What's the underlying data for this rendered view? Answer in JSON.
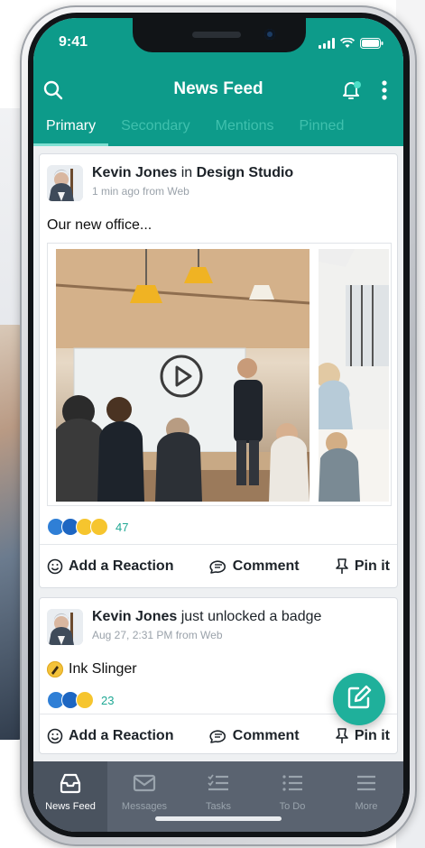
{
  "status_bar": {
    "time": "9:41"
  },
  "header": {
    "title": "News Feed",
    "icons": [
      "search-icon",
      "bell-icon",
      "more-vertical-icon"
    ]
  },
  "tabs": [
    {
      "label": "Primary",
      "active": true
    },
    {
      "label": "Secondary",
      "active": false
    },
    {
      "label": "Mentions",
      "active": false
    },
    {
      "label": "Pinned",
      "active": false
    }
  ],
  "posts": [
    {
      "author": "Kevin Jones",
      "connector": "in",
      "target": "Design Studio",
      "meta": "1 min ago from Web",
      "text": "Our new office...",
      "reaction_count": "47",
      "actions": {
        "react": "Add a Reaction",
        "comment": "Comment",
        "pin": "Pin it"
      }
    },
    {
      "author": "Kevin Jones",
      "activity": "just unlocked a badge",
      "meta": "Aug 27, 2:31 PM from Web",
      "badge_name": "Ink Slinger",
      "reaction_count": "23",
      "actions": {
        "react": "Add a Reaction",
        "comment": "Comment",
        "pin": "Pin it"
      }
    }
  ],
  "bottom_nav": [
    {
      "label": "News Feed",
      "icon": "inbox-icon",
      "active": true
    },
    {
      "label": "Messages",
      "icon": "envelope-icon",
      "active": false
    },
    {
      "label": "Tasks",
      "icon": "checklist-icon",
      "active": false
    },
    {
      "label": "To Do",
      "icon": "list-icon",
      "active": false
    },
    {
      "label": "More",
      "icon": "menu-icon",
      "active": false
    }
  ],
  "colors": {
    "brand": "#0d9b8a",
    "accent": "#1fb09b",
    "nav_bg": "#5a6370"
  }
}
